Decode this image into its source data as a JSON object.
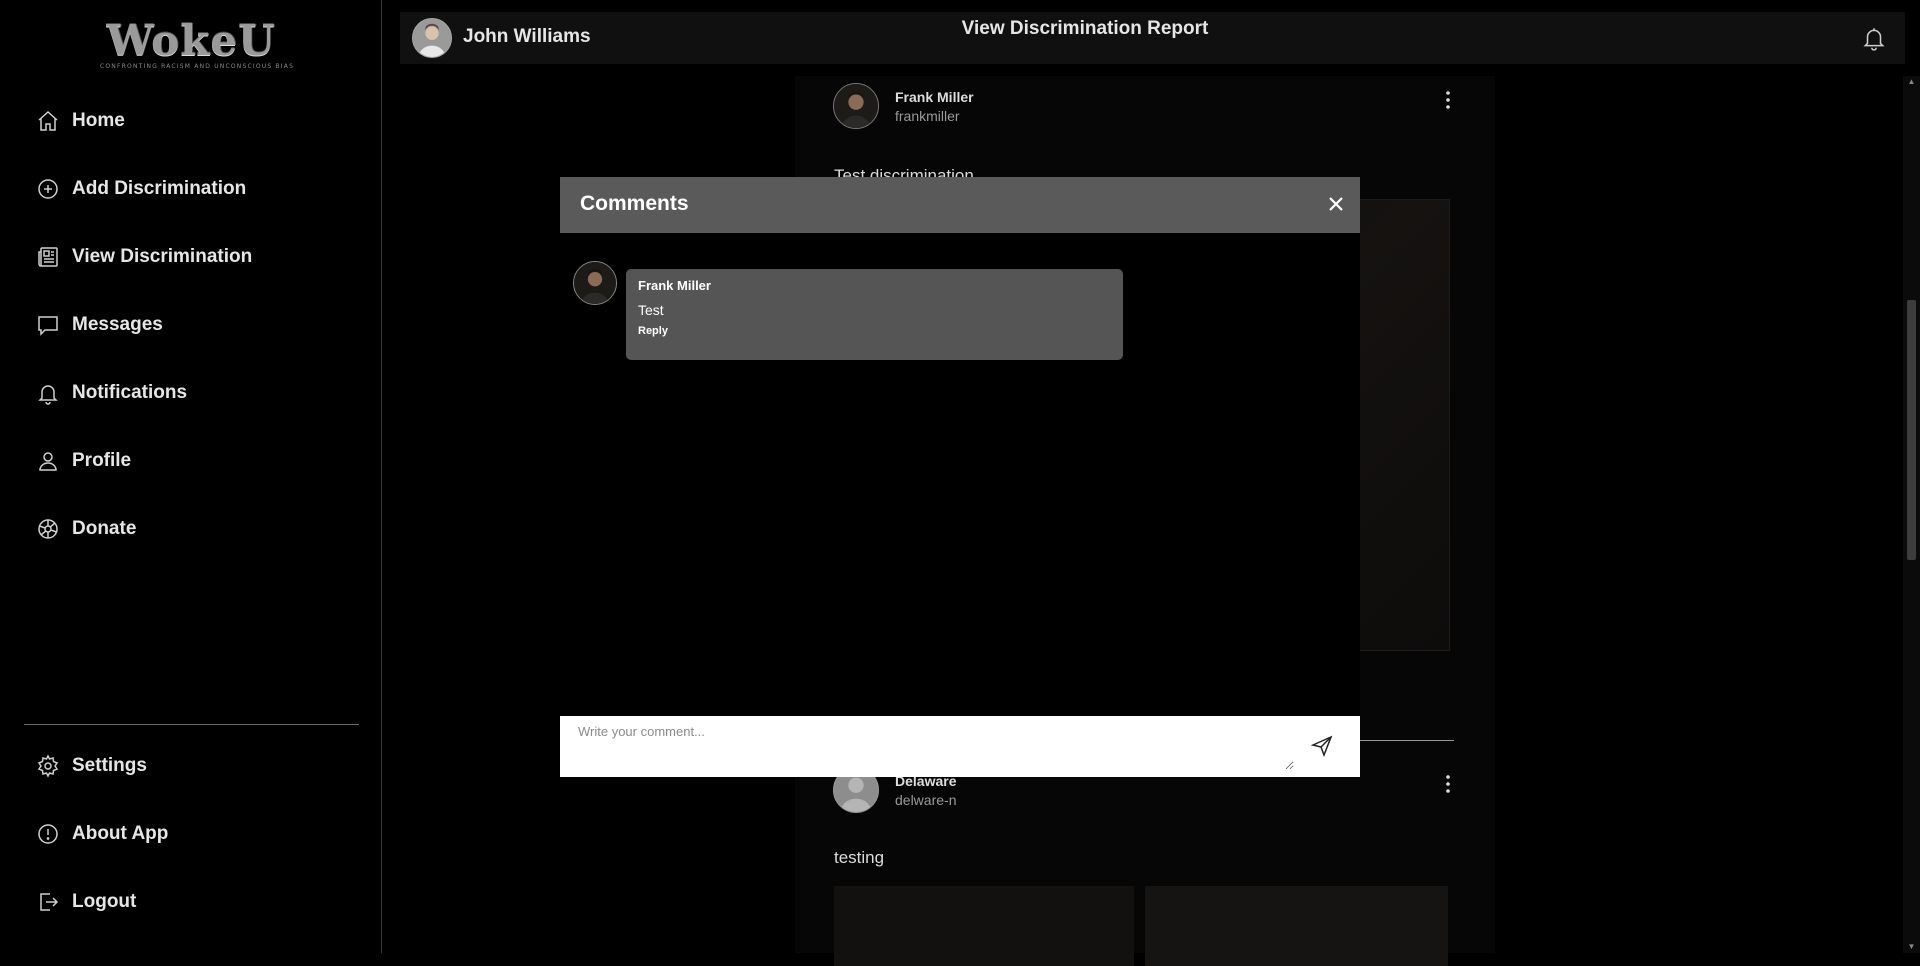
{
  "app": {
    "logo_text": "WokeU",
    "logo_tagline": "CONFRONTING RACISM AND UNCONSCIOUS BIAS"
  },
  "sidebar": {
    "items": [
      {
        "label": "Home",
        "icon": "home-icon"
      },
      {
        "label": "Add Discrimination",
        "icon": "plus-circle-icon"
      },
      {
        "label": "View Discrimination",
        "icon": "newspaper-icon"
      },
      {
        "label": "Messages",
        "icon": "chat-icon"
      },
      {
        "label": "Notifications",
        "icon": "bell-icon"
      },
      {
        "label": "Profile",
        "icon": "user-icon"
      },
      {
        "label": "Donate",
        "icon": "donate-icon"
      }
    ],
    "bottom_items": [
      {
        "label": "Settings",
        "icon": "gear-icon"
      },
      {
        "label": "About App",
        "icon": "info-icon"
      },
      {
        "label": "Logout",
        "icon": "logout-icon"
      }
    ]
  },
  "header": {
    "user_name": "John Williams",
    "title": "View Discrimination Report"
  },
  "feed": {
    "posts": [
      {
        "name": "Frank Miller",
        "handle": "frankmiller",
        "text": "Test discrimination"
      },
      {
        "name": "Delaware",
        "handle": "delware-n",
        "text": "testing"
      }
    ]
  },
  "modal": {
    "title": "Comments",
    "comments": [
      {
        "author": "Frank Miller",
        "text": "Test",
        "reply_label": "Reply"
      }
    ],
    "input_placeholder": "Write your comment..."
  },
  "colors": {
    "background": "#000000",
    "modal_header": "#5a5a5a",
    "comment_bubble": "#555555"
  }
}
